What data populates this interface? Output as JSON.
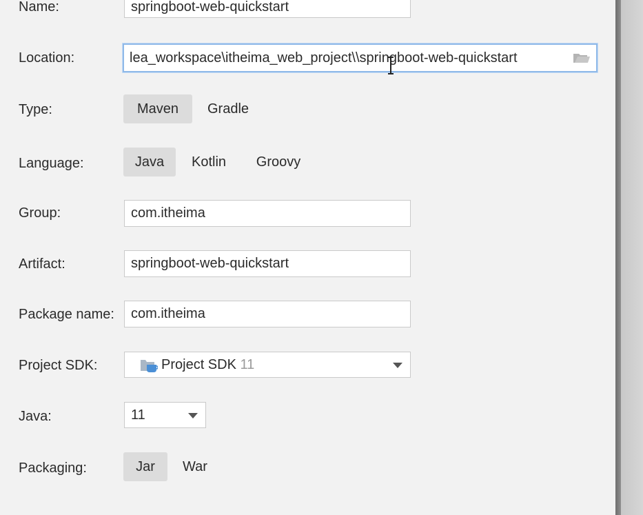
{
  "form": {
    "name": {
      "label": "Name:",
      "value": "springboot-web-quickstart"
    },
    "location": {
      "label": "Location:",
      "value": "lea_workspace\\itheima_web_project\\\\springboot-web-quickstart"
    },
    "type": {
      "label": "Type:",
      "options": [
        "Maven",
        "Gradle"
      ],
      "selected": "Maven"
    },
    "language": {
      "label": "Language:",
      "options": [
        "Java",
        "Kotlin",
        "Groovy"
      ],
      "selected": "Java"
    },
    "group": {
      "label": "Group:",
      "value": "com.itheima"
    },
    "artifact": {
      "label": "Artifact:",
      "value": "springboot-web-quickstart"
    },
    "package_name": {
      "label": "Package name:",
      "value": "com.itheima"
    },
    "project_sdk": {
      "label": "Project SDK:",
      "name": "Project SDK",
      "version": "11"
    },
    "java": {
      "label": "Java:",
      "value": "11"
    },
    "packaging": {
      "label": "Packaging:",
      "options": [
        "Jar",
        "War"
      ],
      "selected": "Jar"
    }
  },
  "icons": {
    "location_browse": "folder-icon",
    "sdk": "sdk-folder-icon",
    "dropdown": "chevron-down-icon",
    "cursor": "text-cursor-icon"
  },
  "colors": {
    "background": "#f2f2f2",
    "field_border": "#c9c9c9",
    "focus_border": "#8fb9e8",
    "selected_segment": "#dcdcdc",
    "sdk_icon_blue": "#4a8fd6"
  }
}
